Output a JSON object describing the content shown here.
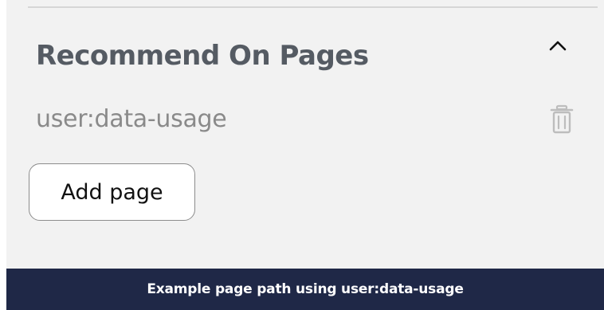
{
  "section": {
    "title": "Recommend On Pages",
    "collapse_icon": "chevron-up-icon"
  },
  "pages": [
    {
      "path": "user:data-usage",
      "delete_icon": "trash-icon"
    }
  ],
  "actions": {
    "add_page_label": "Add page"
  },
  "footer": {
    "text": "Example page path using user:data-usage"
  },
  "colors": {
    "panel_bg": "#f2f2f2",
    "title_text": "#555b63",
    "path_text": "#8a8a8a",
    "icon_muted": "#bdbdbd",
    "footer_bg": "#1f2847",
    "footer_text": "#ffffff"
  }
}
